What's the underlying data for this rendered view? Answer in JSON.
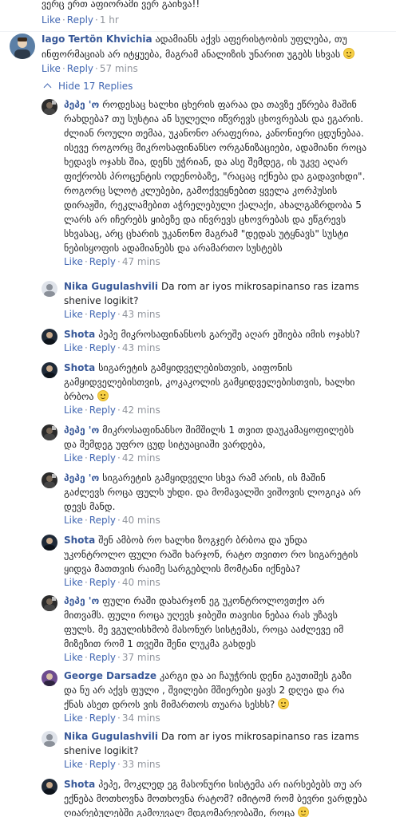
{
  "top_comment_fragment": {
    "text": "ვერც ერთ აფიორამი ვერ გაიხვა!!",
    "like": "Like",
    "reply": "Reply",
    "time": "1 hr"
  },
  "main_comment": {
    "author": "Iago Tertön Khvichia",
    "text": "ადამიანს აქვს აფერისტობის უფლება, თუ ინფორმაციას არ იტყუება, მაგრამ ანალიზის უნარით უგებს სხვას",
    "like": "Like",
    "reply": "Reply",
    "time": "57 mins"
  },
  "hide_replies": "Hide 17 Replies",
  "replies": [
    {
      "author": "პეპე 'ო",
      "text": "როდესაც ხალხი ცხერის ფარაა და თავზე ეწრება მაშინ რახდება? თუ სუსტია ან სულელი იწვრევს ცხოვრებას და ეგარის. ძლიან როული თემაა, უკანონო არაფერია, კანონიერი ცდუნებაა. ისევე როგორც მიკროსაფინანსო ორგანიზაციები, ადამიანი როცა ხედავს ოჯახს შია, დენს უჭრიან, და ასე შემდეგ, ის უკვე აღარ ფიქრობს პროცენტის ოდენობაზე, \"რაცაც იქნება და გადავიხდი\". როგორც სლოტ კლუბები, გამოქვეყნებით ყველა კორპუსის დირაჟში, რეკლამებით აჭრელებული ქალაქი, ახალგაზრდობა 5 ლარს არ იჩერებს ყიბეზე და ინვრევს ცხოვრებას და ეწგრევს სხვასაც, არც ცხარის უკანონო მაგრამ \"დედას უტყნავს\" სუსტი ნებისყოფის ადამიანებს და არამართო სუსტებს",
      "like": "Like",
      "reply": "Reply",
      "time": "47 mins"
    },
    {
      "author": "Nika Gugulashvili",
      "text": "Da rom ar iyos mikrosapinanso ras izams shenive logikit?",
      "like": "Like",
      "reply": "Reply",
      "time": "43 mins"
    },
    {
      "author": "Shota",
      "text": "პეპე მიკროსაფინანსოს გარეშე აღარ ეშიება იმის ოჯახს?",
      "like": "Like",
      "reply": "Reply",
      "time": "43 mins"
    },
    {
      "author": "Shota",
      "text": "სიგარეტის გამყიდველებისთვის, აიფონის გამყიდველებისთვის, კოკაკოლის გამყიდველებისთვის, ხალხი ბრბოა",
      "like": "Like",
      "reply": "Reply",
      "time": "42 mins"
    },
    {
      "author": "პეპე 'ო",
      "text": "მიკროსაფინანსო შიმშილს 1 თვით დაუკამაყოფილებს და შემდეგ უფრო ცუდ სიტუაციაში ვარდება,",
      "like": "Like",
      "reply": "Reply",
      "time": "42 mins"
    },
    {
      "author": "პეპე 'ო",
      "text": "სიგარეტის გამყიდველი სხვა რამ არის, ის მაშინ გაძლევს როცა ფულს უხდი. და მომავალში ვიშოვის ლოგიკა არ დევს მანდ.",
      "like": "Like",
      "reply": "Reply",
      "time": "40 mins"
    },
    {
      "author": "Shota",
      "text": "შენ ამბობ რო ხალხი ზოგჯერ ბრბოა და უნდა უკონტროლო ფული რაში ხარჯონ, რატო თვითო რო სიგარეტის ყიდვა მათთვის რაიმე სარგებლის მომტანი იქნება?",
      "like": "Like",
      "reply": "Reply",
      "time": "40 mins"
    },
    {
      "author": "პეპე 'ო",
      "text": "ფული რაში დახარჯონ ეგ უკონტროლოვთქო არ მითვამს. ფული როცა უღევს ჯიბეში თავისი ნებაა რას უზავს ფულს. მე ვგულისხმობ მასონურ სისტემას, როცა ააძლევე იმ მიზეზით რომ 1 თვეში შენი ლუკმა გახდეს",
      "like": "Like",
      "reply": "Reply",
      "time": "37 mins"
    },
    {
      "author": "George Darsadze",
      "text": "კარგი და აი ჩაუჭრის დენი გაუთიშეს გაზი და ნუ არ აქვს ფული , შვილები მშიერები ყავს 2 დღეა და რა ქნას ასეთ დროს ვის მიმართოს თუარა სესხს?",
      "like": "Like",
      "reply": "Reply",
      "time": "34 mins"
    },
    {
      "author": "Nika Gugulashvili",
      "text": "Da rom ar iyos mikrosapinanso ras izams shenive logikit?",
      "like": "Like",
      "reply": "Reply",
      "time": "33 mins"
    },
    {
      "author": "Shota",
      "text": "პეპე, მოკლედ ეგ მასონური სისტემა არ იარსებებს თუ არ ექნება მოთხოვნა მოთხოვნა რატომ? იმიტომ რომ ბევრი ვარდება ღიარებულებში გამოუვალ მდგომარეობაში, როცა",
      "like": "Like",
      "reply": "Reply",
      "time": ""
    }
  ],
  "avatar_colors": {
    "iago": "#5b7fa6",
    "pepe": "#2b2b2b",
    "nika": "#8a9099",
    "shota": "#1f2a38",
    "george": "#6d4c8f"
  }
}
